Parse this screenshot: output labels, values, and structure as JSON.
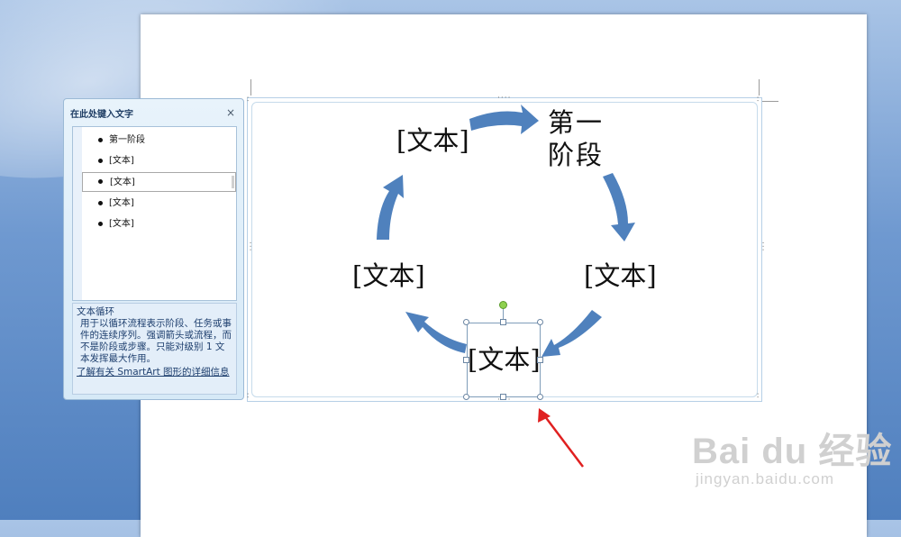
{
  "text_pane": {
    "title": "在此处键入文字",
    "close_glyph": "×",
    "items": [
      {
        "label": "第一阶段"
      },
      {
        "label": "[文本]"
      },
      {
        "label": "[文本]"
      },
      {
        "label": "[文本]"
      },
      {
        "label": "[文本]"
      }
    ],
    "desc_title": "文本循环",
    "desc_body": "用于以循环流程表示阶段、任务或事件的连续序列。强调箭头或流程，而不是阶段或步骤。只能对级别 1 文本发挥最大作用。",
    "desc_link": "了解有关 SmartArt 图形的详细信息"
  },
  "diagram": {
    "nodes": [
      {
        "label": "第一阶段",
        "line1": "第一",
        "line2": "阶段"
      },
      {
        "label": "[文本]"
      },
      {
        "label": "[文本]"
      },
      {
        "label": "[文本]"
      },
      {
        "label": "[文本]"
      }
    ],
    "arrow_color": "#4f81bd",
    "annotation_color": "#e02020"
  },
  "watermark": {
    "main": "Bai du 经验",
    "sub": "jingyan.baidu.com"
  }
}
